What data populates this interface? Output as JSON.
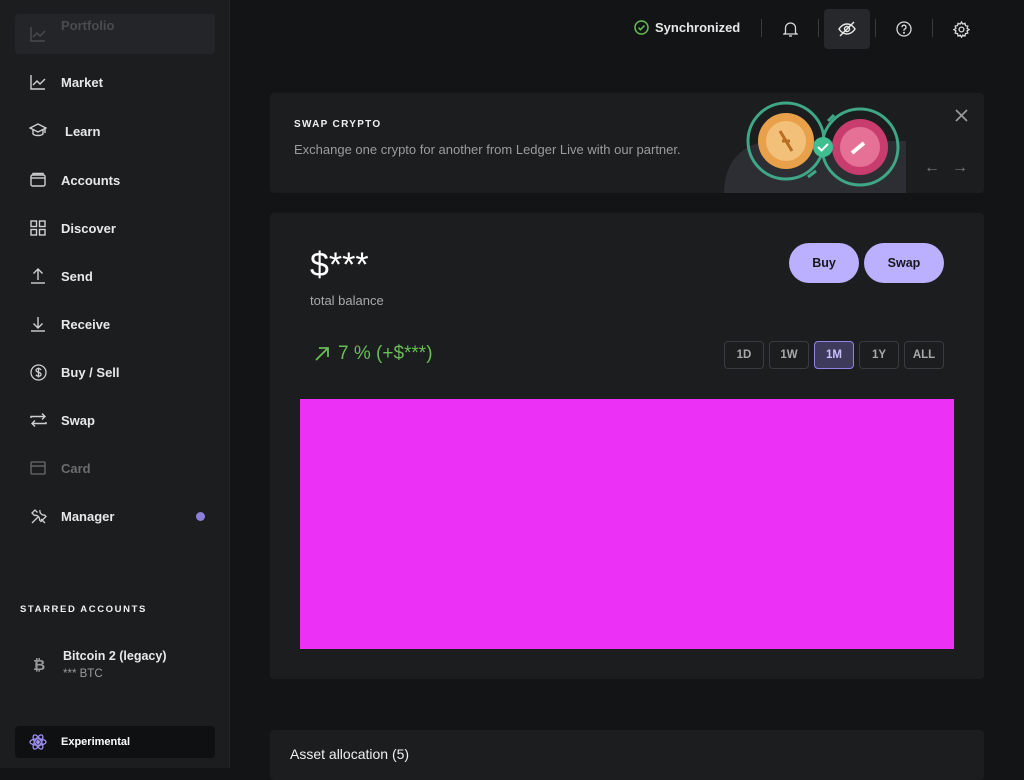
{
  "sidebar": {
    "items": [
      {
        "label": "Portfolio",
        "icon": "chart-icon"
      },
      {
        "label": "Market",
        "icon": "trend-icon"
      },
      {
        "label": "Learn",
        "icon": "graduation-cap-icon"
      },
      {
        "label": "Accounts",
        "icon": "wallet-icon"
      },
      {
        "label": "Discover",
        "icon": "grid-icon"
      },
      {
        "label": "Send",
        "icon": "upload-icon"
      },
      {
        "label": "Receive",
        "icon": "download-icon"
      },
      {
        "label": "Buy / Sell",
        "icon": "dollar-circle-icon"
      },
      {
        "label": "Swap",
        "icon": "swap-icon"
      },
      {
        "label": "Card",
        "icon": "card-icon"
      },
      {
        "label": "Manager",
        "icon": "tools-icon"
      }
    ],
    "starred_title": "STARRED ACCOUNTS",
    "starred": [
      {
        "name": "Bitcoin 2 (legacy)",
        "balance": "*** BTC",
        "icon": "bitcoin-icon"
      }
    ],
    "experimental_label": "Experimental"
  },
  "topbar": {
    "sync_label": "Synchronized"
  },
  "banner": {
    "title": "SWAP CRYPTO",
    "description": "Exchange one crypto for another from Ledger Live with our partner.",
    "prev_arrow": "←",
    "next_arrow": "→"
  },
  "portfolio": {
    "balance": "$***",
    "balance_label": "total balance",
    "buy_label": "Buy",
    "swap_label": "Swap",
    "delta": "7 % (+$***)",
    "ranges": [
      "1D",
      "1W",
      "1M",
      "1Y",
      "ALL"
    ],
    "selected_range": "1M"
  },
  "asset_allocation": {
    "title": "Asset allocation (5)"
  },
  "colors": {
    "accent": "#bbb0ff",
    "positive": "#66be54",
    "chart_placeholder": "#ec30f5"
  }
}
